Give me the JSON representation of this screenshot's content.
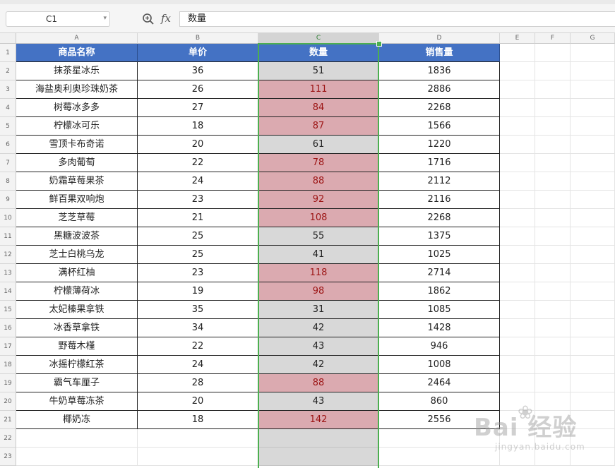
{
  "formula_bar": {
    "cell_ref": "C1",
    "zoom_icon": "zoom-icon",
    "fx_label": "fx",
    "content": "数量"
  },
  "columns": [
    "A",
    "B",
    "C",
    "D",
    "E",
    "F",
    "G"
  ],
  "headers": [
    "商品名称",
    "单价",
    "数量",
    "销售量"
  ],
  "rows": [
    {
      "name": "抹茶星冰乐",
      "price": "36",
      "qty": "51",
      "sales": "1836",
      "highlight": false
    },
    {
      "name": "海盐奥利奥珍珠奶茶",
      "price": "26",
      "qty": "111",
      "sales": "2886",
      "highlight": true
    },
    {
      "name": "树莓冰多多",
      "price": "27",
      "qty": "84",
      "sales": "2268",
      "highlight": true
    },
    {
      "name": "柠檬冰可乐",
      "price": "18",
      "qty": "87",
      "sales": "1566",
      "highlight": true
    },
    {
      "name": "雪顶卡布奇诺",
      "price": "20",
      "qty": "61",
      "sales": "1220",
      "highlight": false
    },
    {
      "name": "多肉葡萄",
      "price": "22",
      "qty": "78",
      "sales": "1716",
      "highlight": true
    },
    {
      "name": "奶霜草莓果茶",
      "price": "24",
      "qty": "88",
      "sales": "2112",
      "highlight": true
    },
    {
      "name": "鲜百果双响炮",
      "price": "23",
      "qty": "92",
      "sales": "2116",
      "highlight": true
    },
    {
      "name": "芝芝草莓",
      "price": "21",
      "qty": "108",
      "sales": "2268",
      "highlight": true
    },
    {
      "name": "黑糖波波茶",
      "price": "25",
      "qty": "55",
      "sales": "1375",
      "highlight": false
    },
    {
      "name": "芝士白桃乌龙",
      "price": "25",
      "qty": "41",
      "sales": "1025",
      "highlight": false
    },
    {
      "name": "满杯红柚",
      "price": "23",
      "qty": "118",
      "sales": "2714",
      "highlight": true
    },
    {
      "name": "柠檬薄荷冰",
      "price": "19",
      "qty": "98",
      "sales": "1862",
      "highlight": true
    },
    {
      "name": "太妃榛果拿铁",
      "price": "35",
      "qty": "31",
      "sales": "1085",
      "highlight": false
    },
    {
      "name": "冰香草拿铁",
      "price": "34",
      "qty": "42",
      "sales": "1428",
      "highlight": false
    },
    {
      "name": "野莓木槿",
      "price": "22",
      "qty": "43",
      "sales": "946",
      "highlight": false
    },
    {
      "name": "冰摇柠檬红茶",
      "price": "24",
      "qty": "42",
      "sales": "1008",
      "highlight": false
    },
    {
      "name": "霸气车厘子",
      "price": "28",
      "qty": "88",
      "sales": "2464",
      "highlight": true
    },
    {
      "name": "牛奶草莓冻茶",
      "price": "20",
      "qty": "43",
      "sales": "860",
      "highlight": false
    },
    {
      "name": "椰奶冻",
      "price": "18",
      "qty": "142",
      "sales": "2556",
      "highlight": true
    }
  ],
  "row_numbers": [
    "1",
    "2",
    "3",
    "4",
    "5",
    "6",
    "7",
    "8",
    "9",
    "10",
    "11",
    "12",
    "13",
    "14",
    "15",
    "16",
    "17",
    "18",
    "19",
    "20",
    "21",
    "22",
    "23"
  ],
  "colors": {
    "header_fill": "#4472c4",
    "highlight_fill": "#dbaab0",
    "highlight_text": "#9c1414",
    "selection_border": "#4caf50"
  },
  "watermark": {
    "brand": "Bai 经验",
    "url": "jingyan.baidu.com"
  }
}
